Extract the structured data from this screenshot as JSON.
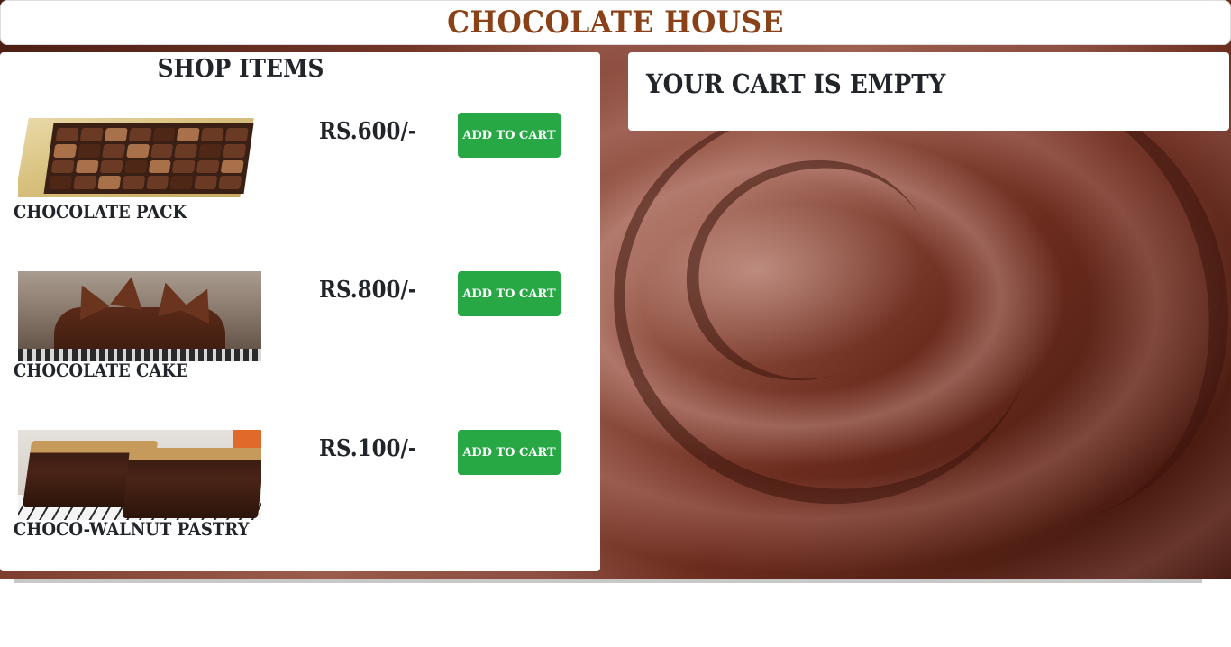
{
  "header": {
    "title": "CHOCOLATE HOUSE"
  },
  "shop": {
    "title": "SHOP ITEMS",
    "items": [
      {
        "name": "CHOCOLATE PACK",
        "price": "RS.600/-",
        "button_label": "ADD TO CART",
        "image": "chocolate-pack-image"
      },
      {
        "name": "CHOCOLATE CAKE",
        "price": "RS.800/-",
        "button_label": "ADD TO CART",
        "image": "chocolate-cake-image"
      },
      {
        "name": "CHOCO-WALNUT PASTRY",
        "price": "RS.100/-",
        "button_label": "ADD TO CART",
        "image": "choco-walnut-pastry-image"
      }
    ]
  },
  "cart": {
    "message": "YOUR CART IS EMPTY"
  },
  "colors": {
    "title_brown": "#8a4117",
    "button_green": "#28a745",
    "text_dark": "#212529"
  }
}
